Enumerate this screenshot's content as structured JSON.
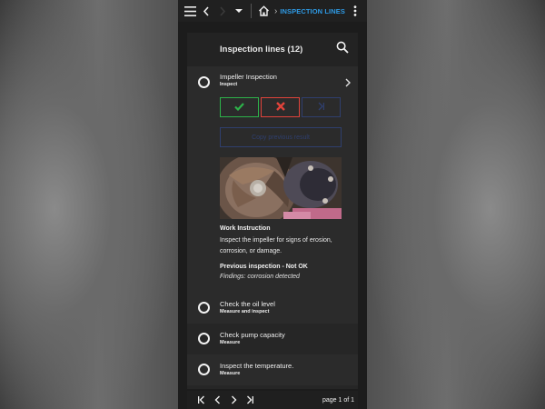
{
  "topbar": {
    "breadcrumb": "INSPECTION LINES",
    "accent_color": "#2e9be6",
    "icons": [
      "menu-icon",
      "back-icon",
      "forward-icon",
      "dropdown-icon",
      "home-icon",
      "more-vert-icon"
    ]
  },
  "panel": {
    "title": "Inspection lines (12)",
    "search_icon": "search-icon"
  },
  "expanded_item": {
    "title": "Impeller Inspection",
    "subtitle": "Inspect",
    "ok_color": "#2db34a",
    "nok_color": "#e0433b",
    "copy_label": "Copy previous result",
    "work_instruction_title": "Work Instruction",
    "work_instruction_text": "Inspect the impeller for signs of erosion, corrosion, or damage.",
    "previous_title": "Previous inspection - Not OK",
    "previous_findings": "Findings: corrosion detected"
  },
  "items": [
    {
      "title": "Check the oil level",
      "subtitle": "Measure and inspect"
    },
    {
      "title": "Check pump capacity",
      "subtitle": "Measure"
    },
    {
      "title": "Inspect the temperature.",
      "subtitle": "Measure"
    }
  ],
  "pagination": {
    "label": "page 1 of 1"
  }
}
